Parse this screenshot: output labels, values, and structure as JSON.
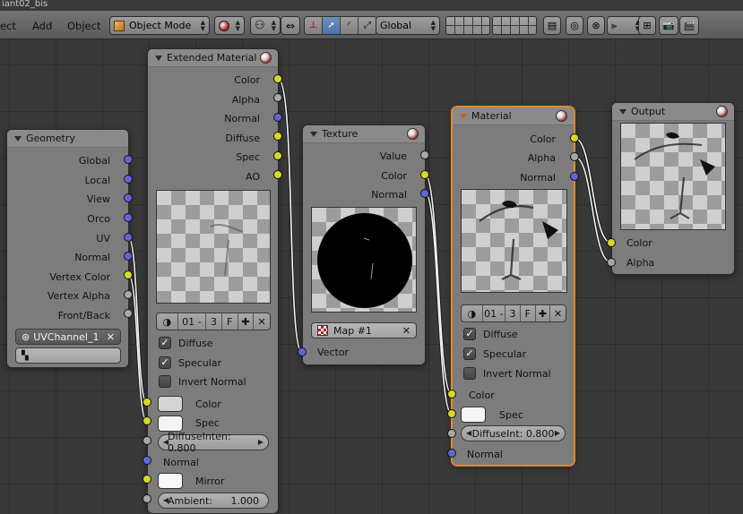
{
  "window": {
    "title": "iant02_bis"
  },
  "header": {
    "menus": [
      "ect",
      "Add",
      "Object"
    ],
    "mode": "Object Mode",
    "orientation": "Global",
    "icons": [
      "viewport-shading-icon",
      "pivot-icon",
      "manipulator-icon",
      "translate-icon",
      "rotate-icon",
      "scale-icon",
      "layers-icon",
      "lock-icon",
      "proportional-icon",
      "snap-icon",
      "render-icon",
      "anim-render-icon"
    ]
  },
  "colors": {
    "socket_color": "#d8d82a",
    "socket_value": "#a8a8a8",
    "socket_vector": "#6264d8",
    "active_border": "#e08a2e",
    "wire": "#ffffff"
  },
  "nodes": {
    "geometry": {
      "title": "Geometry",
      "outputs": [
        "Global",
        "Local",
        "View",
        "Orco",
        "UV",
        "Normal",
        "Vertex Color",
        "Vertex Alpha",
        "Front/Back"
      ],
      "uv_map": "UVChannel_1",
      "vcol_layer": ""
    },
    "extended_material": {
      "title": "Extended Material",
      "outputs": [
        "Color",
        "Alpha",
        "Normal",
        "Diffuse",
        "Spec",
        "AO"
      ],
      "material_slot": {
        "name": "01 -",
        "users": "3",
        "fake": "F"
      },
      "checks": [
        {
          "label": "Diffuse",
          "checked": true
        },
        {
          "label": "Specular",
          "checked": true
        },
        {
          "label": "Invert Normal",
          "checked": false
        }
      ],
      "inputs": {
        "color": "Color",
        "spec": "Spec",
        "diffuse_inten": "DiffuseInten: 0.800",
        "normal": "Normal",
        "mirror": "Mirror",
        "ambient_label": "Ambient:",
        "ambient_value": "1.000"
      },
      "color_swatch": "#d4d4d4",
      "spec_swatch": "#f4f4f4",
      "mirror_swatch": "#f8f8f8"
    },
    "texture": {
      "title": "Texture",
      "outputs": [
        "Value",
        "Color",
        "Normal"
      ],
      "texture_name": "Map #1",
      "input": "Vector"
    },
    "material": {
      "title": "Material",
      "outputs": [
        "Color",
        "Alpha",
        "Normal"
      ],
      "material_slot": {
        "name": "01 -",
        "users": "3",
        "fake": "F"
      },
      "checks": [
        {
          "label": "Diffuse",
          "checked": true
        },
        {
          "label": "Specular",
          "checked": true
        },
        {
          "label": "Invert Normal",
          "checked": false
        }
      ],
      "inputs": {
        "color": "Color",
        "spec": "Spec",
        "diffuse_int": "DiffuseInt:   0.800",
        "normal": "Normal"
      },
      "spec_swatch": "#f6f6f6"
    },
    "output": {
      "title": "Output",
      "inputs": [
        "Color",
        "Alpha"
      ]
    }
  }
}
